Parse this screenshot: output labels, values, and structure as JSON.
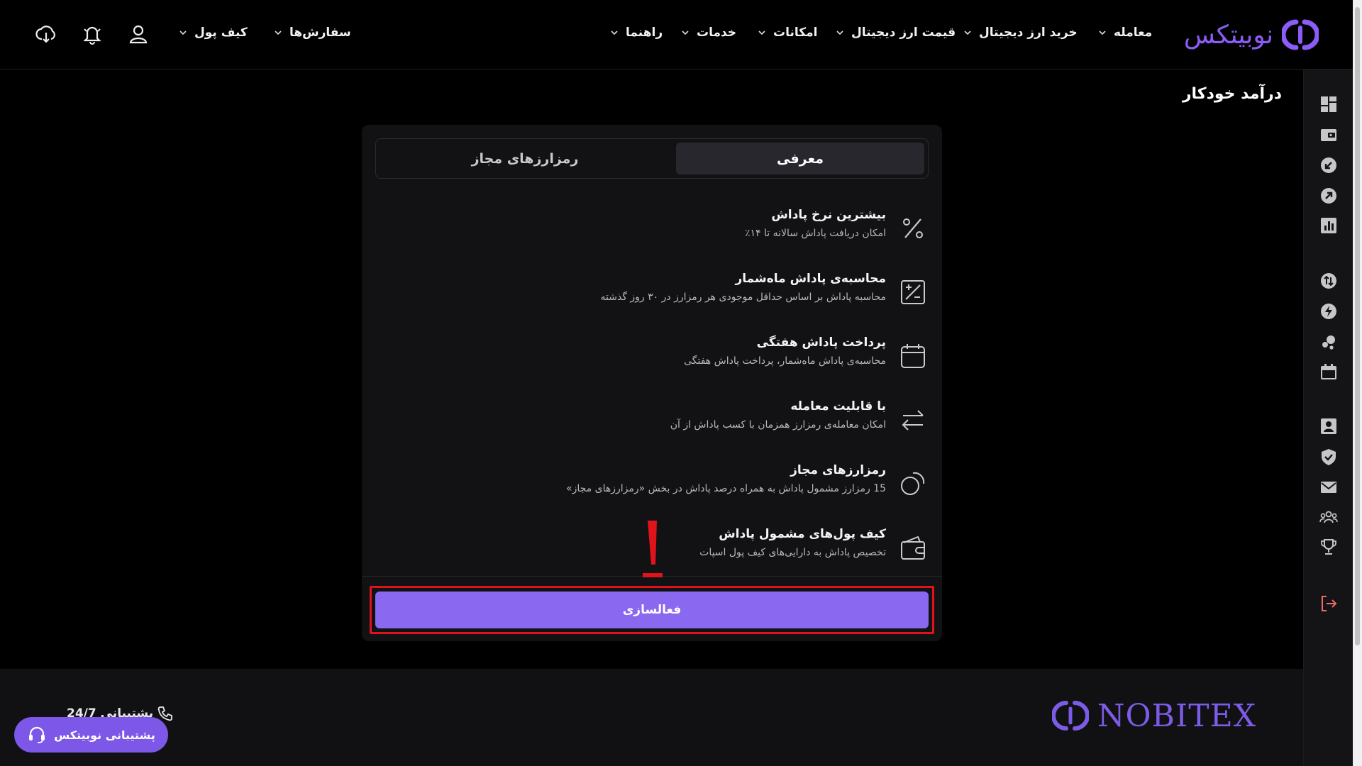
{
  "colors": {
    "background": "#000000",
    "card": "#121215",
    "accent": "#8b68f0",
    "brand": "#7c5ce6",
    "highlight": "#e0131b",
    "logout": "#ef6b6b"
  },
  "header": {
    "logo_text": "نوبیتکس",
    "nav": [
      {
        "label": "معامله",
        "icon": "chevron-down-icon"
      },
      {
        "label": "خرید ارز دیجیتال",
        "icon": "chevron-down-icon"
      },
      {
        "label": "قیمت ارز دیجیتال",
        "icon": "chevron-down-icon"
      },
      {
        "label": "امکانات",
        "icon": "chevron-down-icon"
      },
      {
        "label": "خدمات",
        "icon": "chevron-down-icon"
      },
      {
        "label": "راهنما",
        "icon": "chevron-down-icon"
      }
    ],
    "user_menu": [
      {
        "label": "سفارش‌ها",
        "icon": "chevron-down-icon"
      },
      {
        "label": "کیف پول",
        "icon": "chevron-down-icon"
      }
    ],
    "icons": [
      "user-icon",
      "bell-icon",
      "download-icon"
    ]
  },
  "sidebar": {
    "icons": [
      "dashboard-icon",
      "wallet-icon",
      "deposit-icon",
      "withdraw-icon",
      "chart-icon",
      "convert-icon",
      "lightning-icon",
      "staking-icon",
      "calendar-icon",
      "profile-icon",
      "security-icon",
      "mail-icon",
      "referral-icon",
      "trophy-icon",
      "logout-icon"
    ]
  },
  "main": {
    "page_title": "درآمد خودکار",
    "tabs": [
      {
        "label": "معرفی",
        "active": true
      },
      {
        "label": "رمزارزهای مجاز",
        "active": false
      }
    ],
    "features": [
      {
        "icon": "percent-icon",
        "title": "بیشترین نرخ پاداش",
        "desc": "امکان دریافت پاداش سالانه تا ۱۴٪"
      },
      {
        "icon": "calculator-icon",
        "title": "محاسبه‌ی پاداش ماه‌شمار",
        "desc": "محاسبه پاداش بر اساس حداقل موجودی هر رمزارز در ۳۰ روز گذشته"
      },
      {
        "icon": "calendar-icon",
        "title": "پرداخت پاداش هفتگی",
        "desc": "محاسبه‌ی پاداش ماه‌شمار، پرداخت پاداش هفتگی"
      },
      {
        "icon": "swap-icon",
        "title": "با قابلیت معامله",
        "desc": "امکان معامله‌ی رمزارز همزمان با کسب پاداش از آن"
      },
      {
        "icon": "coins-icon",
        "title": "رمزارزهای مجاز",
        "desc": "15 رمزارز مشمول پاداش به همراه درصد پاداش در بخش «رمزارزهای مجاز»"
      },
      {
        "icon": "wallet-icon",
        "title": "کیف پول‌های مشمول پاداش",
        "desc": "تخصیص پاداش به دارایی‌های کیف پول اسپات"
      }
    ],
    "activate_label": "فعالسازی"
  },
  "footer": {
    "logo_text": "NOBITEX",
    "support_phone": "پشتیبانی 24/7",
    "support_button": "پشتیبانی نوبیتکس"
  }
}
